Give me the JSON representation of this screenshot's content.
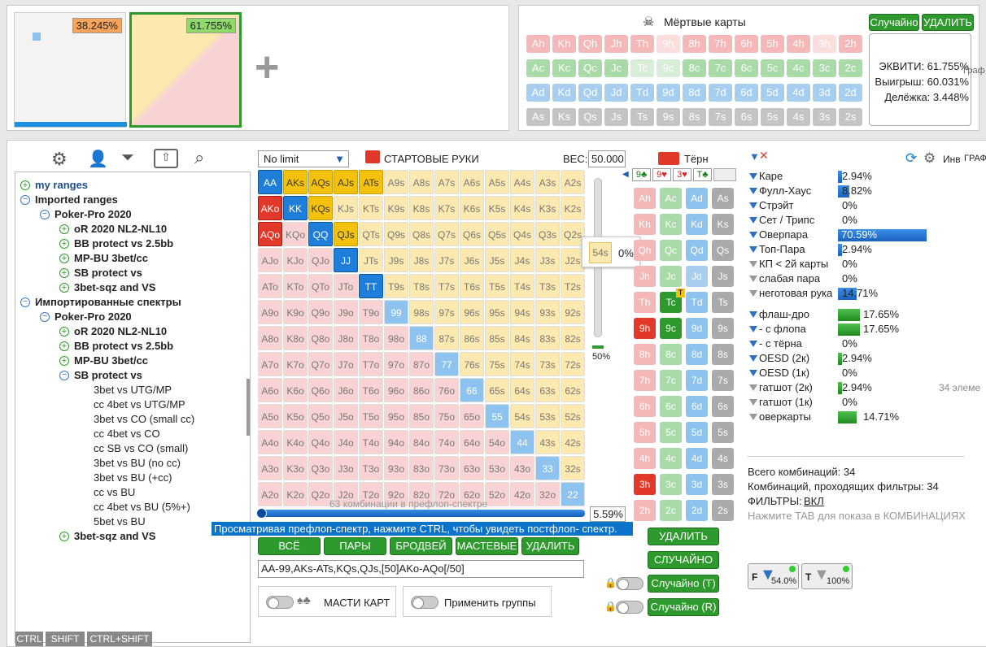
{
  "top": {
    "pct_left": "38.245%",
    "pct_right": "61.755%",
    "add": "+"
  },
  "dead": {
    "title": "Мёртвые карты",
    "random": "Случайно",
    "delete": "УДАЛИТЬ",
    "rows": [
      [
        "Ah",
        "Kh",
        "Qh",
        "Jh",
        "Th",
        "9h",
        "8h",
        "7h",
        "6h",
        "5h",
        "4h",
        "3h",
        "2h"
      ],
      [
        "Ac",
        "Kc",
        "Qc",
        "Jc",
        "Tc",
        "9c",
        "8c",
        "7c",
        "6c",
        "5c",
        "4c",
        "3c",
        "2c"
      ],
      [
        "Ad",
        "Kd",
        "Qd",
        "Jd",
        "Td",
        "9d",
        "8d",
        "7d",
        "6d",
        "5d",
        "4d",
        "3d",
        "2d"
      ],
      [
        "As",
        "Ks",
        "Qs",
        "Js",
        "Ts",
        "9s",
        "8s",
        "7s",
        "6s",
        "5s",
        "4s",
        "3s",
        "2s"
      ]
    ],
    "equity": "ЭКВИТИ: 61.755%",
    "win": "Выигрыш: 60.031%",
    "tie": "Делёжка: 3.448%",
    "cut": "Граф"
  },
  "tree": [
    {
      "t": "my ranges",
      "lvl": 0,
      "b": true,
      "blue": true,
      "ic": "+"
    },
    {
      "t": "Imported ranges",
      "lvl": 0,
      "b": true,
      "ic": "-"
    },
    {
      "t": "Poker-Pro 2020",
      "lvl": 1,
      "b": true,
      "ic": "-"
    },
    {
      "t": "oR 2020 NL2-NL10",
      "lvl": 2,
      "b": true,
      "ic": "+"
    },
    {
      "t": "BB protect vs 2.5bb",
      "lvl": 2,
      "b": true,
      "ic": "+"
    },
    {
      "t": "MP-BU 3bet/cc",
      "lvl": 2,
      "b": true,
      "ic": "+"
    },
    {
      "t": "SB protect vs",
      "lvl": 2,
      "b": true,
      "ic": "+"
    },
    {
      "t": "3bet-sqz and VS",
      "lvl": 2,
      "b": true,
      "ic": "+"
    },
    {
      "t": "Импортированные спектры",
      "lvl": 0,
      "b": true,
      "ic": "-"
    },
    {
      "t": "Poker-Pro 2020",
      "lvl": 1,
      "b": true,
      "ic": "-"
    },
    {
      "t": "oR 2020 NL2-NL10",
      "lvl": 2,
      "b": true,
      "ic": "+"
    },
    {
      "t": "BB protect vs 2.5bb",
      "lvl": 2,
      "b": true,
      "ic": "+"
    },
    {
      "t": "MP-BU 3bet/cc",
      "lvl": 2,
      "b": true,
      "ic": "+"
    },
    {
      "t": "SB protect vs",
      "lvl": 2,
      "b": true,
      "ic": "-"
    },
    {
      "t": "3bet vs UTG/MP",
      "lvl": 3,
      "b": false,
      "ic": ""
    },
    {
      "t": "cc 4bet vs UTG/MP",
      "lvl": 3,
      "b": false,
      "ic": ""
    },
    {
      "t": "3bet vs CO (small cc)",
      "lvl": 3,
      "b": false,
      "ic": ""
    },
    {
      "t": "cc 4bet vs CO",
      "lvl": 3,
      "b": false,
      "ic": ""
    },
    {
      "t": "cc SB vs CO (small)",
      "lvl": 3,
      "b": false,
      "ic": ""
    },
    {
      "t": "3bet vs BU (no cc)",
      "lvl": 3,
      "b": false,
      "ic": ""
    },
    {
      "t": "3bet vs BU (+cc)",
      "lvl": 3,
      "b": false,
      "ic": ""
    },
    {
      "t": "cc vs BU",
      "lvl": 3,
      "b": false,
      "ic": ""
    },
    {
      "t": "cc 4bet vs BU (5%+)",
      "lvl": 3,
      "b": false,
      "ic": ""
    },
    {
      "t": "5bet vs BU",
      "lvl": 3,
      "b": false,
      "ic": ""
    },
    {
      "t": "3bet-sqz and VS",
      "lvl": 2,
      "b": true,
      "ic": "+"
    }
  ],
  "keys": [
    "CTRL",
    "SHIFT",
    "CTRL+SHIFT"
  ],
  "grid": {
    "limit": "No limit",
    "title": "СТАРТОВЫЕ РУКИ",
    "weight_label": "ВЕС:",
    "weight": "50.000",
    "selected": [
      "AA",
      "AKs",
      "AQs",
      "AJs",
      "ATs",
      "AKo",
      "KK",
      "KQs",
      "AQo",
      "QQ",
      "QJs",
      "JJ",
      "TT"
    ],
    "half": [
      "99",
      "88",
      "77",
      "66",
      "55",
      "44",
      "33",
      "22"
    ],
    "hover_hand": "54s",
    "hover_pct": "0%",
    "slider_pct": "50%",
    "combos": "63 комбинации в префлоп-спектре",
    "range_pct": "5.59%",
    "hint": "Просматривая префлоп-спектр, нажмите CTRL, чтобы увидеть постфлоп- спектр.",
    "btns": [
      "ВСЁ",
      "ПАРЫ",
      "БРОДВЕЙ",
      "МАСТЕВЫЕ",
      "УДАЛИТЬ"
    ],
    "range_text": "AA-99,AKs-ATs,KQs,QJs,[50]AKo-AQo[/50]",
    "suits_label": "МАСТИ КАРТ",
    "groups_label": "Применить группы"
  },
  "turn": {
    "title": "Тёрн",
    "board": [
      "9♣",
      "9♥",
      "3♥",
      "T♣"
    ],
    "tag": "T",
    "btns": [
      "УДАЛИТЬ",
      "СЛУЧАЙНО",
      "Случайно (T)",
      "Случайно (R)"
    ]
  },
  "stats": {
    "cut": "Инв",
    "cut2": "ГРАФ",
    "count_label": "34 элеме",
    "hands": [
      {
        "n": "Каре",
        "v": "2.94%",
        "f": 2.94,
        "g": false,
        "gray": false
      },
      {
        "n": "Фулл-Хаус",
        "v": "8.82%",
        "f": 8.82,
        "g": false,
        "gray": false
      },
      {
        "n": "Стрэйт",
        "v": "0%",
        "f": 0,
        "g": false,
        "gray": false
      },
      {
        "n": "Сет / Трипс",
        "v": "0%",
        "f": 0,
        "g": false,
        "gray": false
      },
      {
        "n": "Оверпара",
        "v": "70.59%",
        "f": 70.59,
        "g": false,
        "gray": false
      },
      {
        "n": "Топ-Пара",
        "v": "2.94%",
        "f": 2.94,
        "g": false,
        "gray": false
      },
      {
        "n": "КП < 2й карты",
        "v": "0%",
        "f": 0,
        "g": false,
        "gray": true
      },
      {
        "n": "слабая пара",
        "v": "0%",
        "f": 0,
        "g": false,
        "gray": true
      },
      {
        "n": "неготовая рука",
        "v": "14.71%",
        "f": 14.71,
        "g": false,
        "gray": true
      }
    ],
    "draws": [
      {
        "n": "флаш-дро",
        "v": "17.65%",
        "f": 17.65,
        "gray": false
      },
      {
        "n": "- с флопа",
        "v": "17.65%",
        "f": 17.65,
        "gray": false
      },
      {
        "n": "- с тёрна",
        "v": "0%",
        "f": 0,
        "gray": false
      },
      {
        "n": "OESD (2к)",
        "v": "2.94%",
        "f": 2.94,
        "gray": false
      },
      {
        "n": "OESD (1к)",
        "v": "0%",
        "f": 0,
        "gray": false
      },
      {
        "n": "гатшот (2к)",
        "v": "2.94%",
        "f": 2.94,
        "gray": true
      },
      {
        "n": "гатшот (1к)",
        "v": "0%",
        "f": 0,
        "gray": true
      },
      {
        "n": "оверкарты",
        "v": "14.71%",
        "f": 14.71,
        "gray": true
      }
    ],
    "total": "Всего комбинаций: 34",
    "passing": "Комбинаций, проходящих фильтры: 34",
    "filters_label": "ФИЛЬТРЫ:",
    "filters_val": "ВКЛ",
    "tab_hint": "Нажмите TAB для показа в КОМБИНАЦИЯХ",
    "f_btn": "54.0%",
    "t_btn": "100%",
    "f_letter": "F",
    "t_letter": "T"
  }
}
